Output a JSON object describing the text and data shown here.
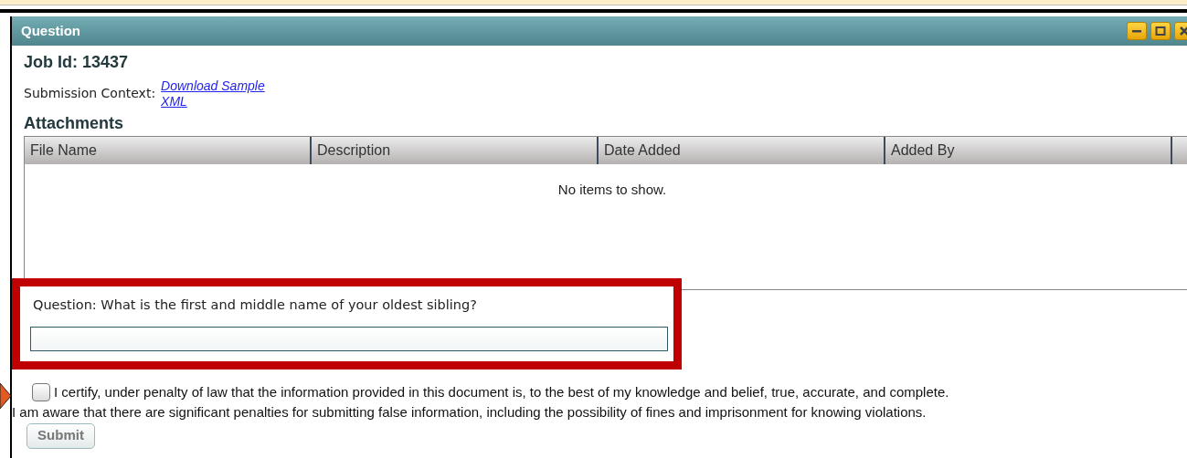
{
  "window": {
    "title": "Question"
  },
  "job_id": "Job Id: 13437",
  "submission_context": {
    "label": "Submission Context:",
    "link": "Download Sample XML"
  },
  "attachments": {
    "heading": "Attachments",
    "columns": [
      "File Name",
      "Description",
      "Date Added",
      "Added By"
    ],
    "empty_text": "No items to show."
  },
  "question": {
    "label": "Question: What is the first and middle name of your oldest sibling?",
    "highlighted": true
  },
  "certify": {
    "checked": false,
    "text": "I certify, under penalty of law that the information provided in this document is, to the best of my knowledge and belief, true, accurate, and complete."
  },
  "notice": "I am aware that there are significant penalties for submitting false information, including the possibility of fines and imprisonment for knowing violations.",
  "submit": {
    "label": "Submit",
    "disabled": true
  }
}
